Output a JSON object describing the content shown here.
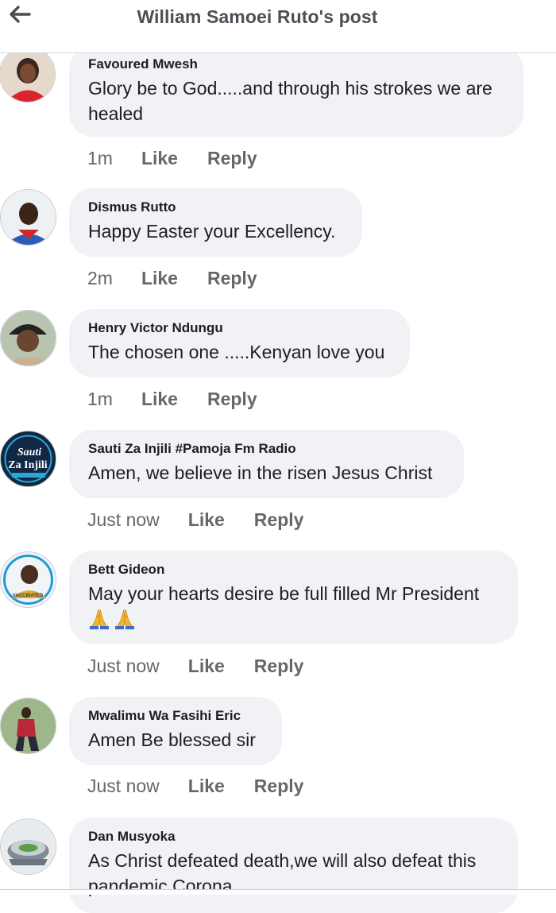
{
  "header": {
    "title": "William Samoei Ruto's post"
  },
  "comments": [
    {
      "author": "Favoured Mwesh",
      "text_lines": [
        "Glory be to God.....and through his strokes we are",
        "healed"
      ],
      "time": "1m",
      "like": "Like",
      "reply": "Reply"
    },
    {
      "author": "Dismus Rutto",
      "text_lines": [
        "Happy Easter your Excellency."
      ],
      "time": "2m",
      "like": "Like",
      "reply": "Reply"
    },
    {
      "author": "Henry Victor Ndungu",
      "text_lines": [
        "The chosen one .....Kenyan love you"
      ],
      "time": "1m",
      "like": "Like",
      "reply": "Reply"
    },
    {
      "author": "Sauti Za Injili #Pamoja Fm Radio",
      "text_lines": [
        "Amen, we believe in the risen Jesus Christ"
      ],
      "time": "Just now",
      "like": "Like",
      "reply": "Reply",
      "avatar_text": [
        "Sauti",
        "Za Injili"
      ]
    },
    {
      "author": "Bett Gideon",
      "text_lines": [
        "May your hearts desire be full filled Mr President"
      ],
      "emoji": [
        "folded-hands",
        "folded-hands"
      ],
      "time": "Just now",
      "like": "Like",
      "reply": "Reply",
      "avatar_text": [
        "VACCINATED"
      ]
    },
    {
      "author": "Mwalimu Wa Fasihi Eric",
      "text_lines": [
        "Amen Be blessed sir"
      ],
      "time": "Just now",
      "like": "Like",
      "reply": "Reply"
    },
    {
      "author": "Dan Musyoka",
      "text_lines": [
        "As Christ defeated death,we will also defeat this",
        "pandemic Corona"
      ]
    }
  ],
  "colors": {
    "bubble": "#f0f2f5",
    "meta": "#65676b",
    "title": "#4b4f56",
    "divider": "#d6d8dc"
  },
  "icons": {
    "back": "arrow-left-icon",
    "emoji": "folded-hands-icon"
  }
}
